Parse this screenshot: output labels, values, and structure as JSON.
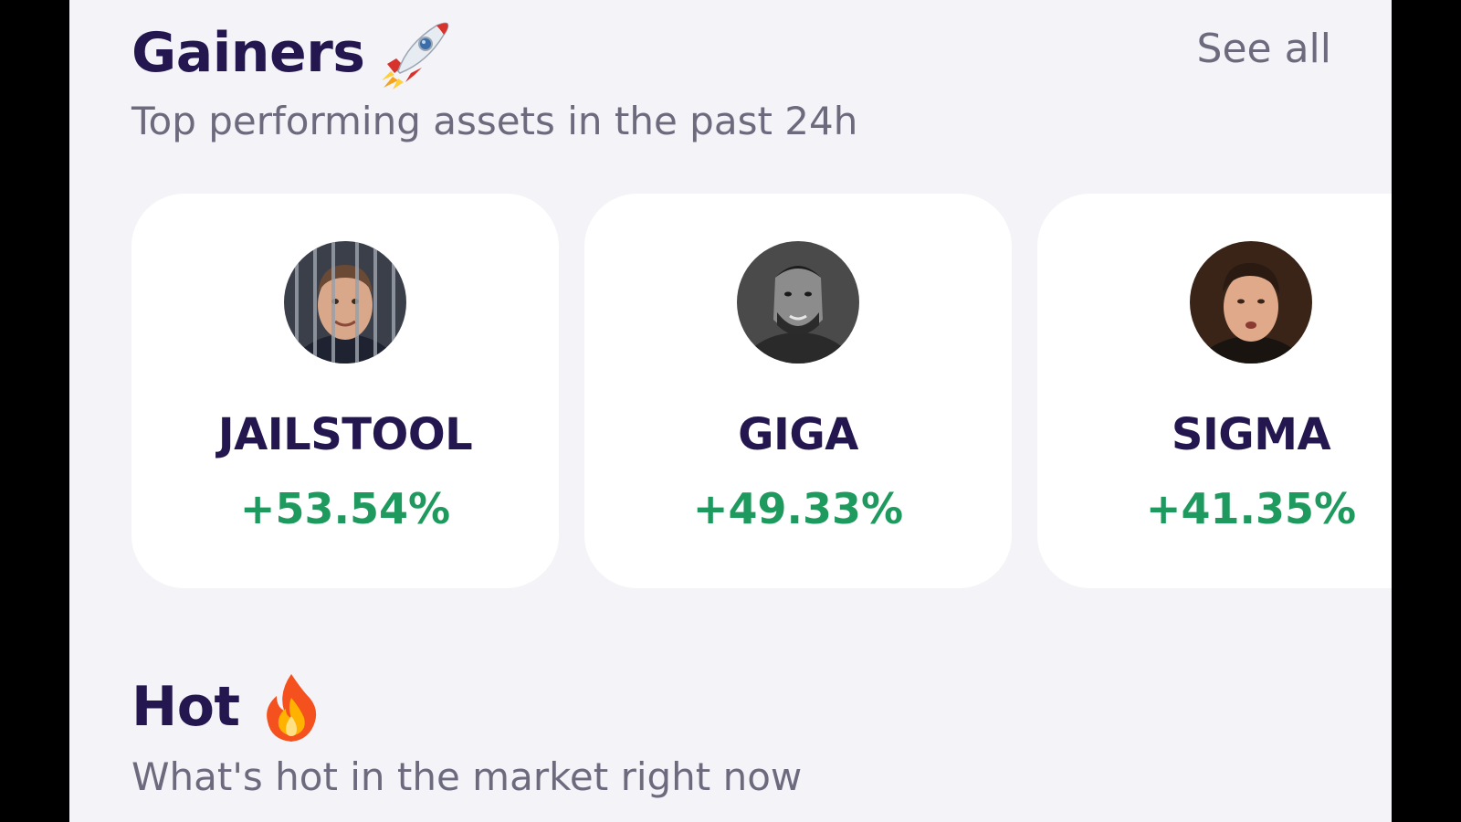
{
  "gainers": {
    "title": "Gainers",
    "title_icon": "rocket-icon",
    "see_all_label": "See all",
    "subtitle": "Top performing assets in the past 24h",
    "cards": [
      {
        "name": "JAILSTOOL",
        "change": "+53.54%",
        "avatar": "jailstool-avatar"
      },
      {
        "name": "GIGA",
        "change": "+49.33%",
        "avatar": "giga-avatar"
      },
      {
        "name": "SIGMA",
        "change": "+41.35%",
        "avatar": "sigma-avatar"
      }
    ]
  },
  "hot": {
    "title": "Hot",
    "title_icon": "fire-icon",
    "subtitle": "What's hot in the market right now"
  },
  "colors": {
    "background": "#f4f3f8",
    "title": "#24174f",
    "muted": "#6e6a7e",
    "positive": "#1f9a5e",
    "card": "#ffffff"
  }
}
